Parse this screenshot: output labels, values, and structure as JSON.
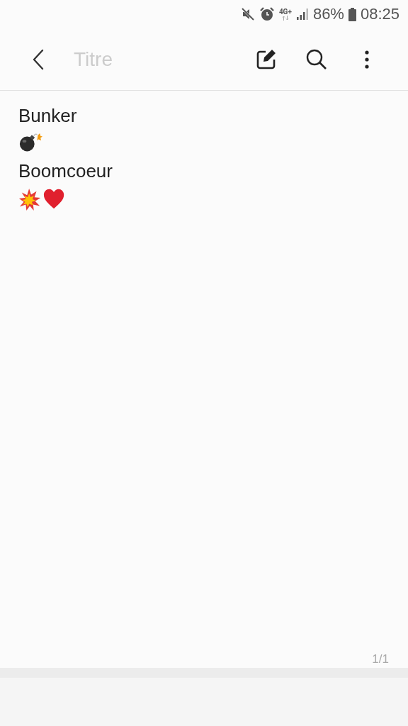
{
  "status_bar": {
    "network": "4G+",
    "battery": "86%",
    "time": "08:25"
  },
  "toolbar": {
    "title": {
      "placeholder": "Titre"
    }
  },
  "note": {
    "lines": [
      {
        "kind": "text",
        "text": "Bunker"
      },
      {
        "kind": "icons",
        "icons": [
          {
            "kind": "bomb"
          }
        ]
      },
      {
        "kind": "text",
        "text": "Boomcoeur"
      },
      {
        "kind": "icons",
        "icons": [
          {
            "kind": "collision"
          },
          {
            "kind": "heart"
          }
        ]
      }
    ]
  },
  "page_indicator": "1/1"
}
